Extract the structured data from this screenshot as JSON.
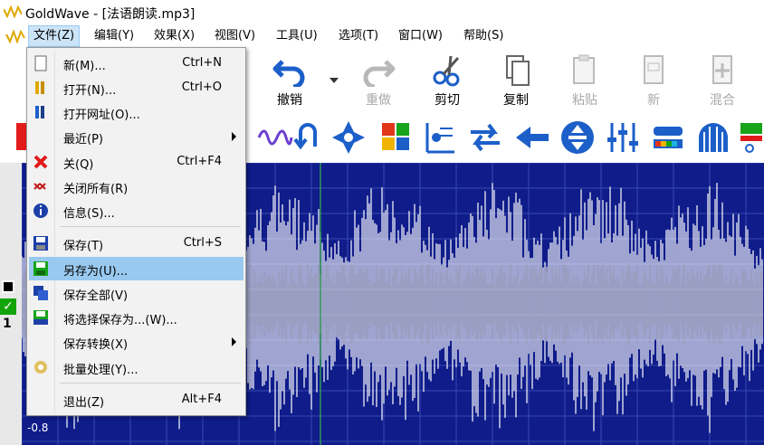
{
  "window": {
    "title": "GoldWave - [法语朗读.mp3]"
  },
  "menubar": {
    "items": [
      "文件(Z)",
      "编辑(Y)",
      "效果(X)",
      "视图(V)",
      "工具(U)",
      "选项(T)",
      "窗口(W)",
      "帮助(S)"
    ]
  },
  "toolbar": {
    "undo": "撤销",
    "redo": "重做",
    "cut": "剪切",
    "copy": "复制",
    "paste": "粘贴",
    "new": "新",
    "mix": "混合"
  },
  "file_menu": {
    "items": [
      {
        "label": "新(M)...",
        "shortcut": "Ctrl+N",
        "icon": "new-file-icon"
      },
      {
        "label": "打开(N)...",
        "shortcut": "Ctrl+O",
        "icon": "open-folder-icon"
      },
      {
        "label": "打开网址(O)...",
        "shortcut": "",
        "icon": "open-url-icon"
      },
      {
        "label": "最近(P)",
        "shortcut": "",
        "icon": "",
        "submenu": true
      },
      {
        "label": "关(Q)",
        "shortcut": "Ctrl+F4",
        "icon": "close-red-x-icon"
      },
      {
        "label": "关闭所有(R)",
        "shortcut": "",
        "icon": "close-all-icon"
      },
      {
        "label": "信息(S)...",
        "shortcut": "",
        "icon": "info-icon"
      },
      {
        "label": "保存(T)",
        "shortcut": "Ctrl+S",
        "icon": "save-icon"
      },
      {
        "label": "另存为(U)...",
        "shortcut": "",
        "icon": "save-as-icon",
        "highlighted": true
      },
      {
        "label": "保存全部(V)",
        "shortcut": "",
        "icon": "save-all-icon"
      },
      {
        "label": "将选择保存为...(W)...",
        "shortcut": "",
        "icon": "save-selection-icon"
      },
      {
        "label": "保存转换(X)",
        "shortcut": "",
        "icon": "",
        "submenu": true
      },
      {
        "label": "批量处理(Y)...",
        "shortcut": "",
        "icon": "batch-icon"
      },
      {
        "label": "退出(Z)",
        "shortcut": "Alt+F4",
        "icon": ""
      }
    ]
  },
  "wave": {
    "scale_bottom": "-0.8",
    "channel_number": "1"
  },
  "colors": {
    "wave_bg": "#0f1c8a",
    "wave_fg": "#ffffff",
    "highlight": "#99c9ef"
  }
}
